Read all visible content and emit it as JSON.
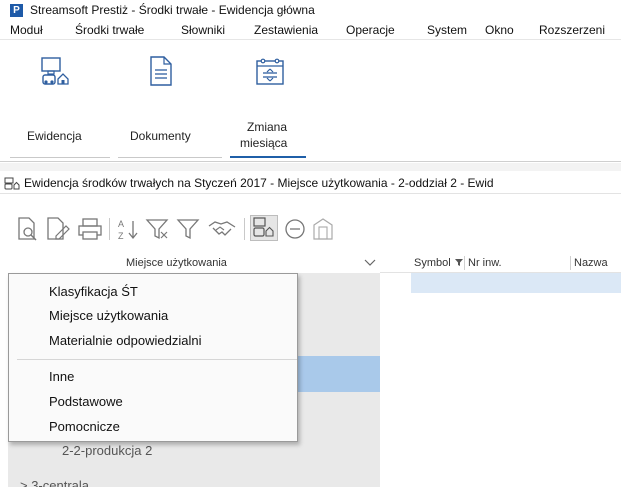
{
  "window": {
    "logo_letter": "P",
    "title": "Streamsoft Prestiż - Środki trwałe - Ewidencja główna"
  },
  "menu": {
    "items": [
      "Moduł",
      "Środki trwałe",
      "Słowniki",
      "Zestawienia",
      "Operacje",
      "System",
      "Okno",
      "Rozszerzeni"
    ]
  },
  "ribbon": {
    "buttons": [
      {
        "label": "Ewidencja",
        "icon": "asset-location-icon",
        "active": false
      },
      {
        "label": "Dokumenty",
        "icon": "document-icon",
        "active": false
      },
      {
        "label_line1": "Zmiana",
        "label_line2": "miesiąca",
        "icon": "calendar-change-icon",
        "active": true
      }
    ]
  },
  "subtitle": {
    "text": "Ewidencja środków trwałych na Styczeń 2017 - Miejsce użytkowania - 2-oddział 2 - Ewid"
  },
  "toolbar": {
    "icons": [
      "preview-icon",
      "edit-document-icon",
      "print-icon",
      "sort-az-icon",
      "filter-clear-icon",
      "filter-icon",
      "handshake-icon",
      "asset-location-icon",
      "minus-circle-icon",
      "building-icon"
    ]
  },
  "left_panel": {
    "header": "Miejsce użytkowania",
    "tree": {
      "visible_item": "2-2-produkcja 2",
      "partial_item": "> 3-centrala"
    }
  },
  "grid": {
    "columns": [
      "Symbol",
      "Nr inw.",
      "Nazwa"
    ]
  },
  "popup_menu": {
    "group1": [
      "Klasyfikacja ŚT",
      "Miejsce użytkowania",
      "Materialnie odpowiedzialni"
    ],
    "group2": [
      "Inne",
      "Podstawowe",
      "Pomocnicze"
    ]
  },
  "colors": {
    "accent": "#1f5fa8",
    "selection": "#a9c9ea",
    "row_selection": "#dbe8f6",
    "panel_bg": "#e9e9e9"
  }
}
